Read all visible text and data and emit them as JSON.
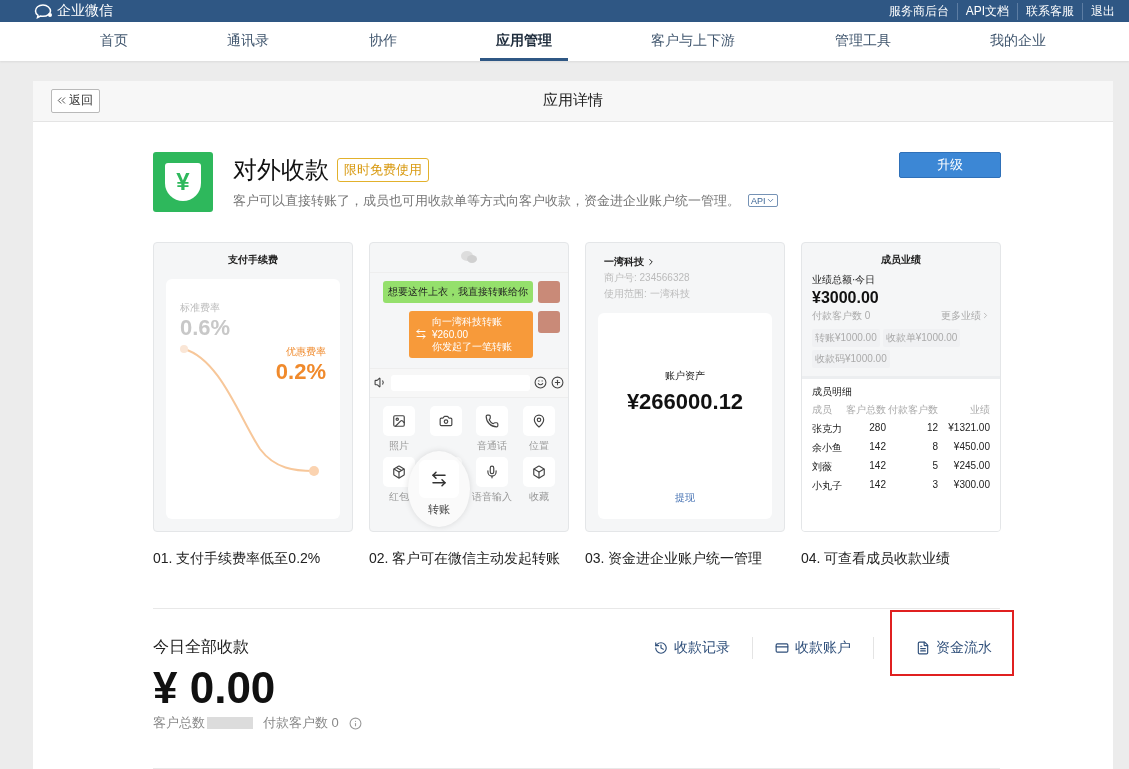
{
  "top_bar": {
    "logo": "企业微信",
    "links": [
      "服务商后台",
      "API文档",
      "联系客服",
      "退出"
    ]
  },
  "nav": {
    "tabs": [
      {
        "label": "首页",
        "selected": false
      },
      {
        "label": "通讯录",
        "selected": false
      },
      {
        "label": "协作",
        "selected": false
      },
      {
        "label": "应用管理",
        "selected": true
      },
      {
        "label": "客户与上下游",
        "selected": false
      },
      {
        "label": "管理工具",
        "selected": false
      },
      {
        "label": "我的企业",
        "selected": false
      }
    ]
  },
  "page_header": {
    "back": "返回",
    "title": "应用详情"
  },
  "app": {
    "icon_glyph": "¥",
    "name": "对外收款",
    "badge": "限时免费使用",
    "description": "客户可以直接转账了，成员也可用收款单等方式向客户收款，资金进企业账户统一管理。",
    "api_tag": "API",
    "upgrade_button": "升级"
  },
  "previews": [
    {
      "kind": "fee",
      "caption": "01. 支付手续费率低至0.2%",
      "title": "支付手续费",
      "standard_label": "标准费率",
      "standard_value": "0.6%",
      "promo_label": "优惠费率",
      "promo_value": "0.2%"
    },
    {
      "kind": "chat",
      "caption": "02. 客户可在微信主动发起转账",
      "message": "想要这件上衣，我直接转账给你",
      "transfer_title": "向一湾科技转账",
      "transfer_amount": "¥260.00",
      "transfer_note": "你发起了一笔转账",
      "tools": [
        "照片",
        "音通话",
        "位置",
        "红包",
        "语音输入",
        "收藏"
      ],
      "transfer_button": "转账"
    },
    {
      "kind": "account",
      "caption": "03. 资金进企业账户统一管理",
      "company": "一湾科技",
      "merchant": "商户号: 234566328",
      "scope": "使用范围: 一湾科技",
      "asset_label": "账户资产",
      "asset_amount": "¥266000.12",
      "withdraw": "提现"
    },
    {
      "kind": "members",
      "caption": "04. 可查看成员收款业绩",
      "title": "成员业绩",
      "total_label": "业绩总额·今日",
      "total": "¥3000.00",
      "paying": "付款客户数 0",
      "more": "更多业绩",
      "chips": [
        "转账¥1000.00",
        "收款单¥1000.00",
        "收款码¥1000.00"
      ],
      "detail_title": "成员明细",
      "columns": [
        "成员",
        "客户总数",
        "付款客户数",
        "业绩"
      ],
      "rows": [
        [
          "张克力",
          "280",
          "12",
          "¥1321.00"
        ],
        [
          "余小鱼",
          "142",
          "8",
          "¥450.00"
        ],
        [
          "刘薇",
          "142",
          "5",
          "¥245.00"
        ],
        [
          "小丸子",
          "142",
          "3",
          "¥300.00"
        ]
      ]
    }
  ],
  "today": {
    "title": "今日全部收款",
    "amount": "¥ 0.00",
    "customer_total_label": "客户总数",
    "paying_customers": "付款客户数 0",
    "links": [
      {
        "label": "收款记录",
        "highlighted": false
      },
      {
        "label": "收款账户",
        "highlighted": false
      },
      {
        "label": "资金流水",
        "highlighted": true
      }
    ]
  }
}
